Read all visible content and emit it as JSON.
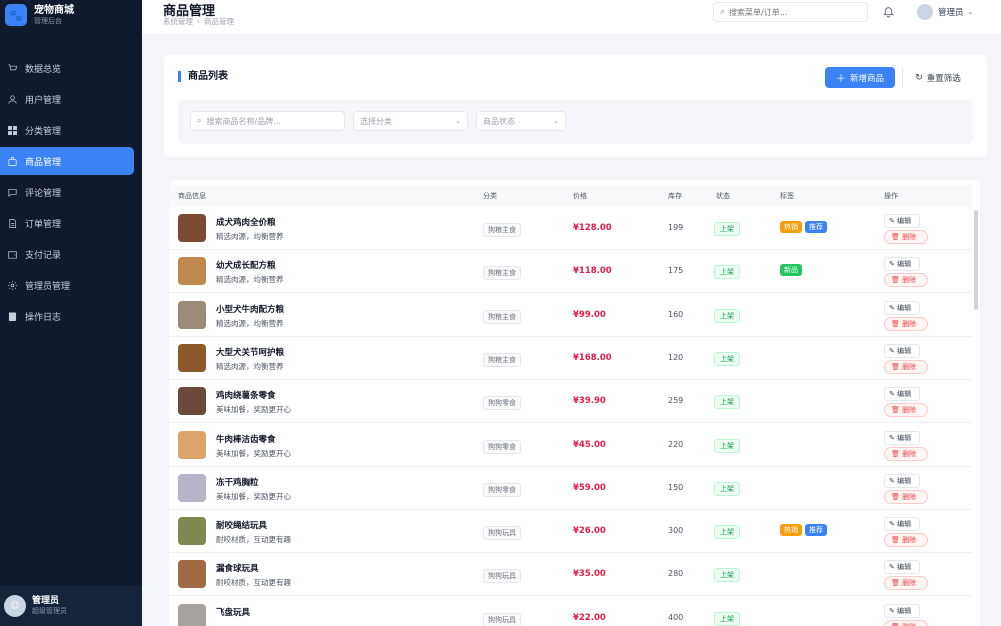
{
  "brand": {
    "title": "宠物商城",
    "subtitle": "管理后台"
  },
  "sidebar": {
    "items": [
      {
        "label": "数据总览",
        "icon": "cart-icon"
      },
      {
        "label": "用户管理",
        "icon": "user-icon"
      },
      {
        "label": "分类管理",
        "icon": "grid-icon"
      },
      {
        "label": "商品管理",
        "icon": "bag-icon",
        "active": true
      },
      {
        "label": "评论管理",
        "icon": "comment-icon"
      },
      {
        "label": "订单管理",
        "icon": "document-icon"
      },
      {
        "label": "支付记录",
        "icon": "wallet-icon"
      },
      {
        "label": "管理员管理",
        "icon": "gear-icon"
      },
      {
        "label": "操作日志",
        "icon": "log-icon"
      }
    ],
    "user": {
      "name": "管理员",
      "role": "超级管理员"
    }
  },
  "header": {
    "title": "商品管理",
    "breadcrumb": [
      "系统管理",
      "商品管理"
    ],
    "search_placeholder": "搜索菜单/订单...",
    "user_label": "管理员"
  },
  "filter": {
    "title": "商品列表",
    "add_label": "新增商品",
    "reset_label": "重置筛选",
    "search_placeholder": "搜索商品名称/品牌...",
    "category_placeholder": "选择分类",
    "status_placeholder": "商品状态"
  },
  "table": {
    "columns": [
      "商品信息",
      "分类",
      "价格",
      "库存",
      "状态",
      "标签",
      "操作"
    ],
    "edit_label": "编辑",
    "delete_label": "删除",
    "rows": [
      {
        "name": "成犬鸡肉全价粮",
        "desc": "精选肉源，均衡营养",
        "category": "狗粮主食",
        "price": "¥128.00",
        "stock": "199",
        "status": "上架",
        "tags": [
          "热销",
          "推荐"
        ],
        "thumb_color": "#7a4a32"
      },
      {
        "name": "幼犬成长配方粮",
        "desc": "精选肉源，均衡营养",
        "category": "狗粮主食",
        "price": "¥118.00",
        "stock": "175",
        "status": "上架",
        "tags": [
          "新品"
        ],
        "thumb_color": "#c08a4e"
      },
      {
        "name": "小型犬牛肉配方粮",
        "desc": "精选肉源，均衡营养",
        "category": "狗粮主食",
        "price": "¥99.00",
        "stock": "160",
        "status": "上架",
        "tags": [],
        "thumb_color": "#9c8b78"
      },
      {
        "name": "大型犬关节呵护粮",
        "desc": "精选肉源，均衡营养",
        "category": "狗粮主食",
        "price": "¥168.00",
        "stock": "120",
        "status": "上架",
        "tags": [],
        "thumb_color": "#8b5a2b"
      },
      {
        "name": "鸡肉绕薯条零食",
        "desc": "美味加餐，奖励更开心",
        "category": "狗狗零食",
        "price": "¥39.90",
        "stock": "259",
        "status": "上架",
        "tags": [],
        "thumb_color": "#6e4a3a"
      },
      {
        "name": "牛肉棒洁齿零食",
        "desc": "美味加餐，奖励更开心",
        "category": "狗狗零食",
        "price": "¥45.00",
        "stock": "220",
        "status": "上架",
        "tags": [],
        "thumb_color": "#d9a36a"
      },
      {
        "name": "冻干鸡胸粒",
        "desc": "美味加餐，奖励更开心",
        "category": "狗狗零食",
        "price": "¥59.00",
        "stock": "150",
        "status": "上架",
        "tags": [],
        "thumb_color": "#b8b4c8"
      },
      {
        "name": "耐咬绳结玩具",
        "desc": "耐咬材质，互动更有趣",
        "category": "狗狗玩具",
        "price": "¥26.00",
        "stock": "300",
        "status": "上架",
        "tags": [
          "热销",
          "推荐"
        ],
        "thumb_color": "#7c8a52"
      },
      {
        "name": "漏食球玩具",
        "desc": "耐咬材质，互动更有趣",
        "category": "狗狗玩具",
        "price": "¥35.00",
        "stock": "280",
        "status": "上架",
        "tags": [],
        "thumb_color": "#a06a44"
      },
      {
        "name": "飞盘玩具",
        "desc": "",
        "category": "狗狗玩具",
        "price": "¥22.00",
        "stock": "400",
        "status": "上架",
        "tags": [],
        "thumb_color": "#a8a29e"
      }
    ]
  },
  "colors": {
    "accent": "#3b82f6",
    "sidebar_bg": "#0f1b2d",
    "price": "#e11d48",
    "status": "#16a34a"
  }
}
